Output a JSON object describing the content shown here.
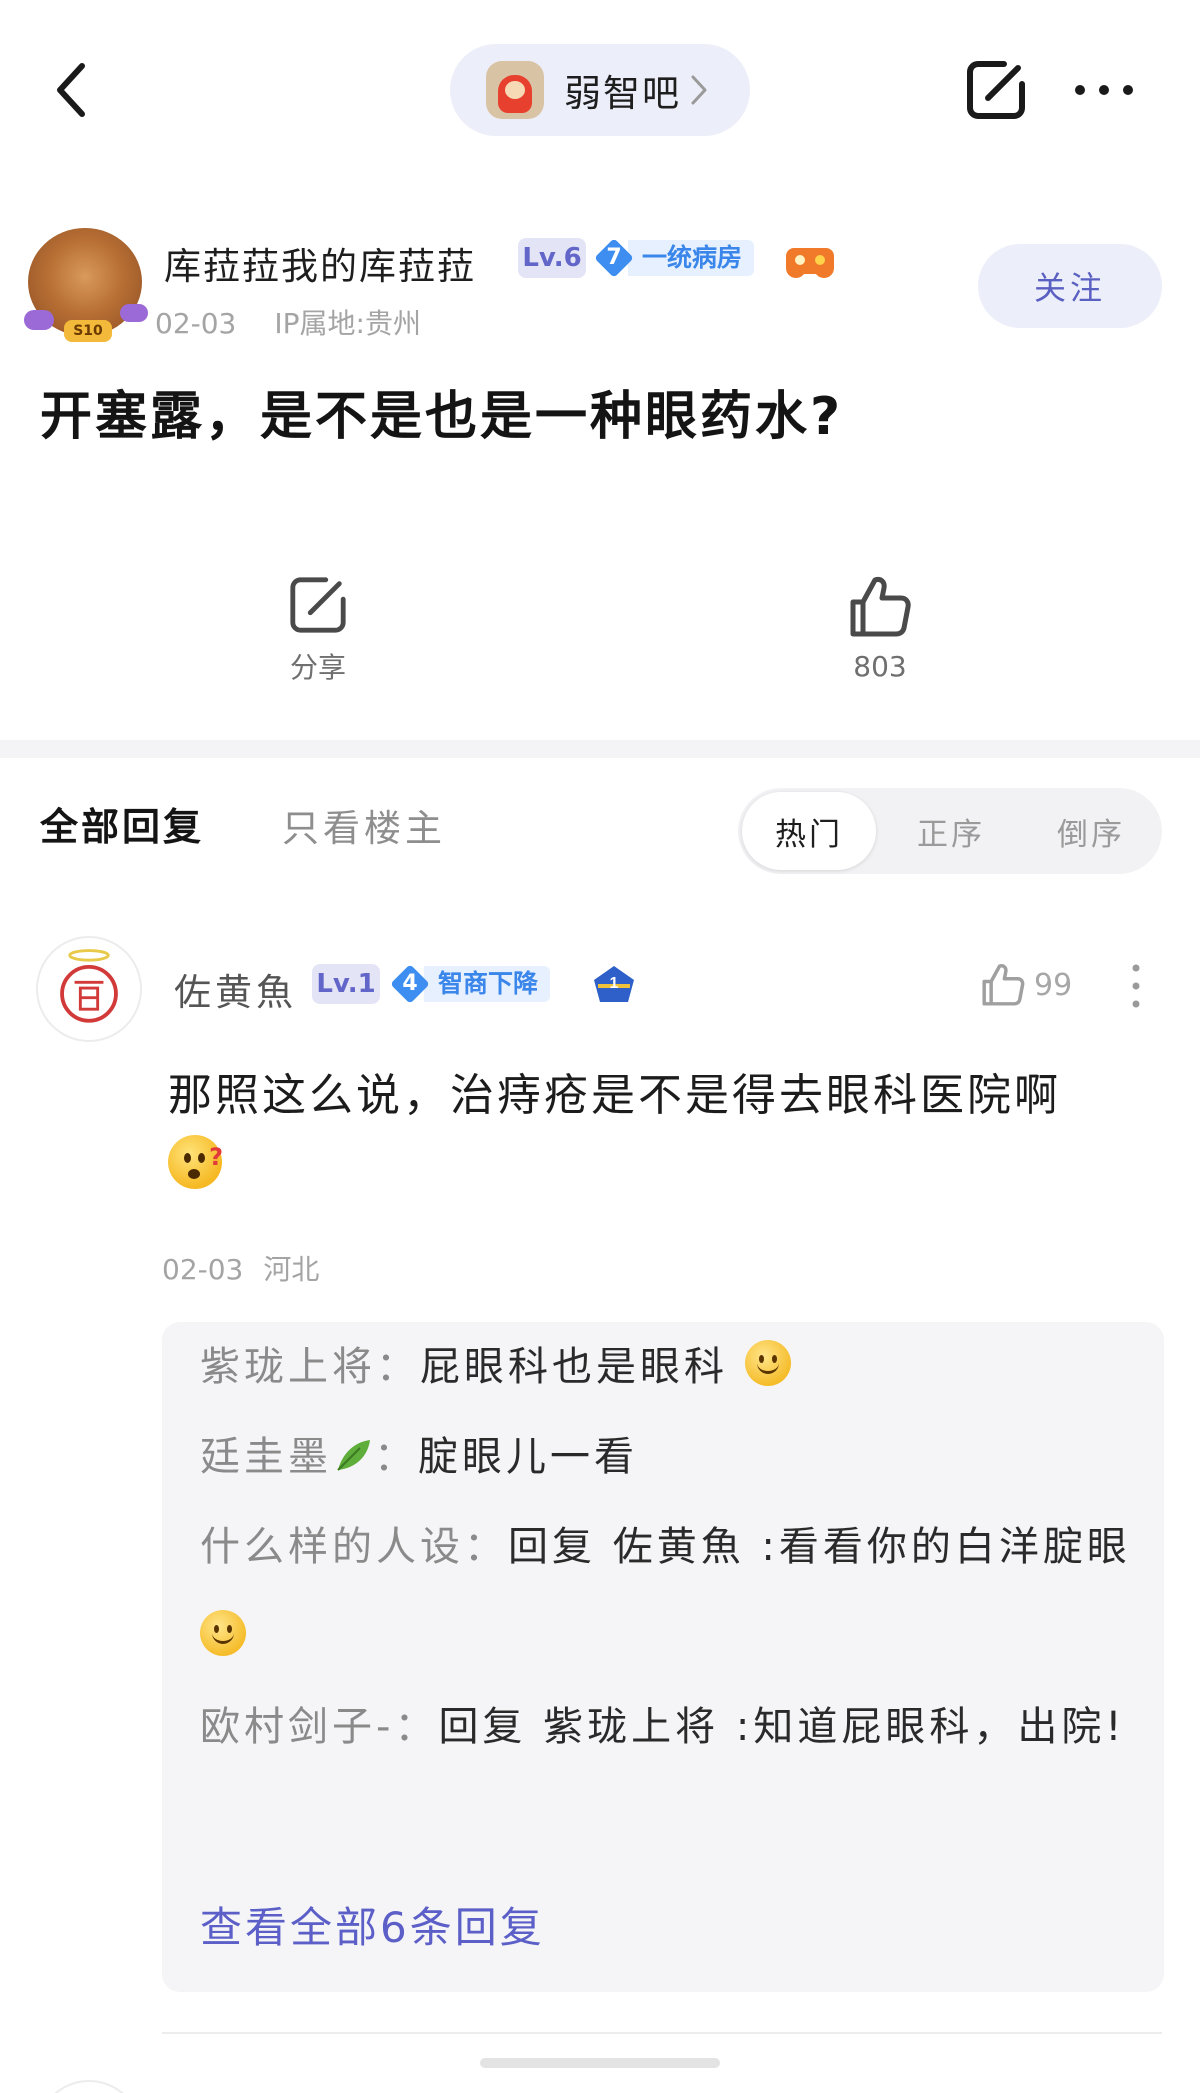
{
  "header": {
    "forum_name": "弱智吧"
  },
  "post": {
    "author": {
      "name": "库菈菈我的库菈菈",
      "level": "Lv.6",
      "honor_level": "7",
      "honor_title": "一统病房",
      "avatar_tag": "S10"
    },
    "date": "02-03",
    "ip_location": "IP属地:贵州",
    "follow_label": "关注",
    "title": "开塞露，是不是也是一种眼药水?",
    "share_label": "分享",
    "like_count": "803"
  },
  "tabs": {
    "all_replies": "全部回复",
    "op_only": "只看楼主",
    "sort_options": [
      "热门",
      "正序",
      "倒序"
    ],
    "active_sort": "热门"
  },
  "comment": {
    "author": "佐黄魚",
    "level": "Lv.1",
    "honor_level": "4",
    "honor_title": "智商下降",
    "rank": "1",
    "like_count": "99",
    "text": "那照这么说，治痔疮是不是得去眼科医院啊",
    "date": "02-03",
    "location": "河北",
    "replies": [
      {
        "who": "紫珑上将",
        "sep": "：",
        "text": "屁眼科也是眼科"
      },
      {
        "who": "廷圭墨",
        "sep": "：",
        "text": "腚眼儿一看"
      },
      {
        "who": "什么样的人设",
        "sep": "：",
        "text": "回复 佐黄魚 :看看你的白洋腚眼"
      },
      {
        "who": "欧村剑子-",
        "sep": "：",
        "text": "回复 紫珑上将 :知道屁眼科，出院!"
      }
    ],
    "view_all": "查看全部6条回复"
  },
  "colors": {
    "accent": "#5b5fc7",
    "pill_bg": "#eceef9",
    "honor_blue": "#3a86ea"
  }
}
